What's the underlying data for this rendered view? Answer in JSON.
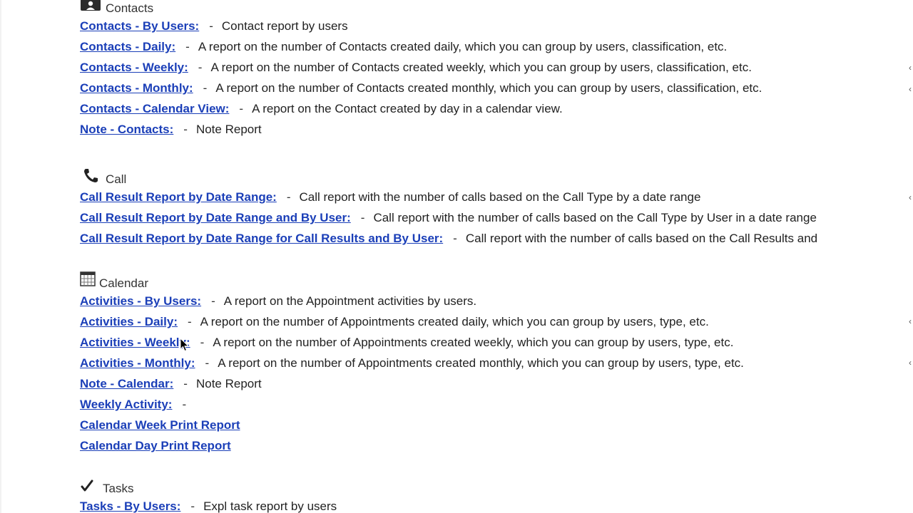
{
  "sections": {
    "contacts": {
      "title": "Contacts",
      "icon": "contact-card-icon",
      "rows": [
        {
          "link": "Contacts - By Users:",
          "desc": "Contact report by users"
        },
        {
          "link": "Contacts - Daily:",
          "desc": "A report on the number of Contacts created daily, which you can group by users, classification, etc."
        },
        {
          "link": "Contacts - Weekly:",
          "desc": "A report on the number of Contacts created weekly, which you can group by users, classification, etc."
        },
        {
          "link": "Contacts - Monthly:",
          "desc": "A report on the number of Contacts created monthly, which you can group by users, classification, etc."
        },
        {
          "link": "Contacts - Calendar View:",
          "desc": "A report on the Contact created by day in a calendar view."
        },
        {
          "link": "Note - Contacts:",
          "desc": "Note Report"
        }
      ]
    },
    "call": {
      "title": "Call",
      "icon": "phone-icon",
      "rows": [
        {
          "link": "Call Result Report by Date Range:",
          "desc": "Call report with the number of calls based on the Call Type by a date range"
        },
        {
          "link": "Call Result Report by Date Range and By User:",
          "desc": "Call report with the number of calls based on the Call Type by User in a date range"
        },
        {
          "link": "Call Result Report by Date Range for Call Results and By User:",
          "desc": "Call report with the number of calls based on the Call Results and"
        }
      ]
    },
    "calendar": {
      "title": "Calendar",
      "icon": "calendar-icon",
      "rows": [
        {
          "link": "Activities - By Users:",
          "desc": "A report on the Appointment activities by users."
        },
        {
          "link": "Activities - Daily:",
          "desc": "A report on the number of Appointments created daily, which you can group by users, type, etc."
        },
        {
          "link": "Activities - Weekly:",
          "desc": "A report on the number of Appointments created weekly, which you can group by users, type, etc."
        },
        {
          "link": "Activities - Monthly:",
          "desc": "A report on the number of Appointments created monthly, which you can group by users, type, etc."
        },
        {
          "link": "Note - Calendar:",
          "desc": "Note Report"
        },
        {
          "link": "Weekly Activity:",
          "desc": ""
        },
        {
          "link": "Calendar Week Print Report"
        },
        {
          "link": "Calendar Day Print Report"
        }
      ]
    },
    "tasks": {
      "title": "Tasks",
      "icon": "checkmark-icon",
      "rows": [
        {
          "link": "Tasks - By Users:",
          "desc": "Expl task report by users"
        }
      ]
    }
  },
  "separator": "-",
  "colors": {
    "link": "#1b3fb8",
    "text": "#222222",
    "background": "#ffffff"
  }
}
